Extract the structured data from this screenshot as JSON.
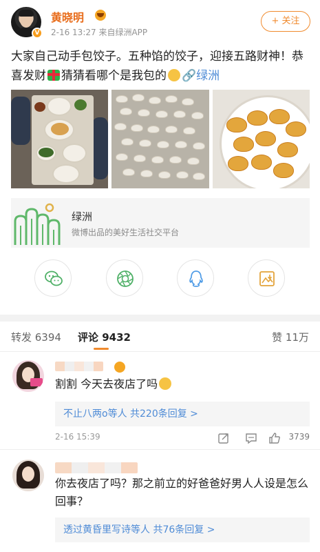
{
  "post": {
    "username": "黄晓明",
    "meta": "2-16 13:27  来自绿洲APP",
    "follow_label": "+ 关注",
    "text_part1": "大家自己动手包饺子。五种馅的饺子，迎接五路财神！恭喜发财",
    "text_part2": "猜猜看哪个是我包的",
    "link_label": "🔗绿洲"
  },
  "share_card": {
    "title": "绿洲",
    "description": "微博出品的美好生活社交平台"
  },
  "share_actions": [
    {
      "icon": "wechat-icon"
    },
    {
      "icon": "moments-icon"
    },
    {
      "icon": "qq-icon"
    },
    {
      "icon": "save-image-icon"
    }
  ],
  "tabs": {
    "repost": "转发 6394",
    "comments": "评论 9432",
    "likes": "赞 11万"
  },
  "comments": [
    {
      "text": "割割 今天去夜店了吗",
      "replies": "不止八两o等人 共220条回复 >",
      "time": "2-16 15:39",
      "likes": "3739"
    },
    {
      "text": "你去夜店了吗？那之前立的好爸爸好男人人设是怎么回事？",
      "replies": "透过黄昏里写诗等人 共76条回复 >"
    }
  ],
  "colors": {
    "accent": "#f08a2d",
    "username": "#e86c1a",
    "link": "#4e8bd6"
  }
}
